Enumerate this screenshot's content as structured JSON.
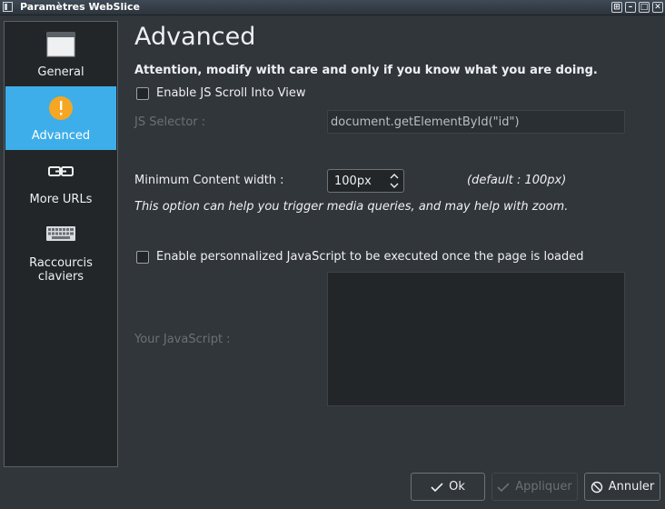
{
  "window": {
    "title": "Paramètres WebSlice",
    "buttons": [
      "keep-above-icon",
      "minimize-icon",
      "maximize-icon",
      "close-icon"
    ]
  },
  "sidebar": {
    "items": [
      {
        "label": "General",
        "icon": "window-icon",
        "active": false
      },
      {
        "label": "Advanced",
        "icon": "warning-icon",
        "active": true
      },
      {
        "label": "More URLs",
        "icon": "link-icon",
        "active": false
      },
      {
        "label": "Raccourcis claviers",
        "icon": "keyboard-icon",
        "active": false
      }
    ]
  },
  "main": {
    "title": "Advanced",
    "warning": "Attention, modify with care and only if you know what you are doing.",
    "js_scroll_checkbox": {
      "label": "Enable JS Scroll Into View",
      "checked": false
    },
    "js_selector": {
      "label": "JS Selector :",
      "value": "document.getElementById(\"id\")"
    },
    "min_width": {
      "label": "Minimum Content width :",
      "value": "100px",
      "default_hint": "(default : 100px)"
    },
    "zoom_hint": "This option can help you trigger media queries, and may help with zoom.",
    "custom_js_checkbox": {
      "label": "Enable personnalized JavaScript to be executed once the page is loaded",
      "checked": false
    },
    "your_js": {
      "label": "Your JavaScript :",
      "value": ""
    }
  },
  "buttons": {
    "ok": "Ok",
    "apply": "Appliquer",
    "cancel": "Annuler"
  },
  "colors": {
    "accent": "#3daee9",
    "warning_icon": "#f5a623",
    "background": "#31363b"
  }
}
